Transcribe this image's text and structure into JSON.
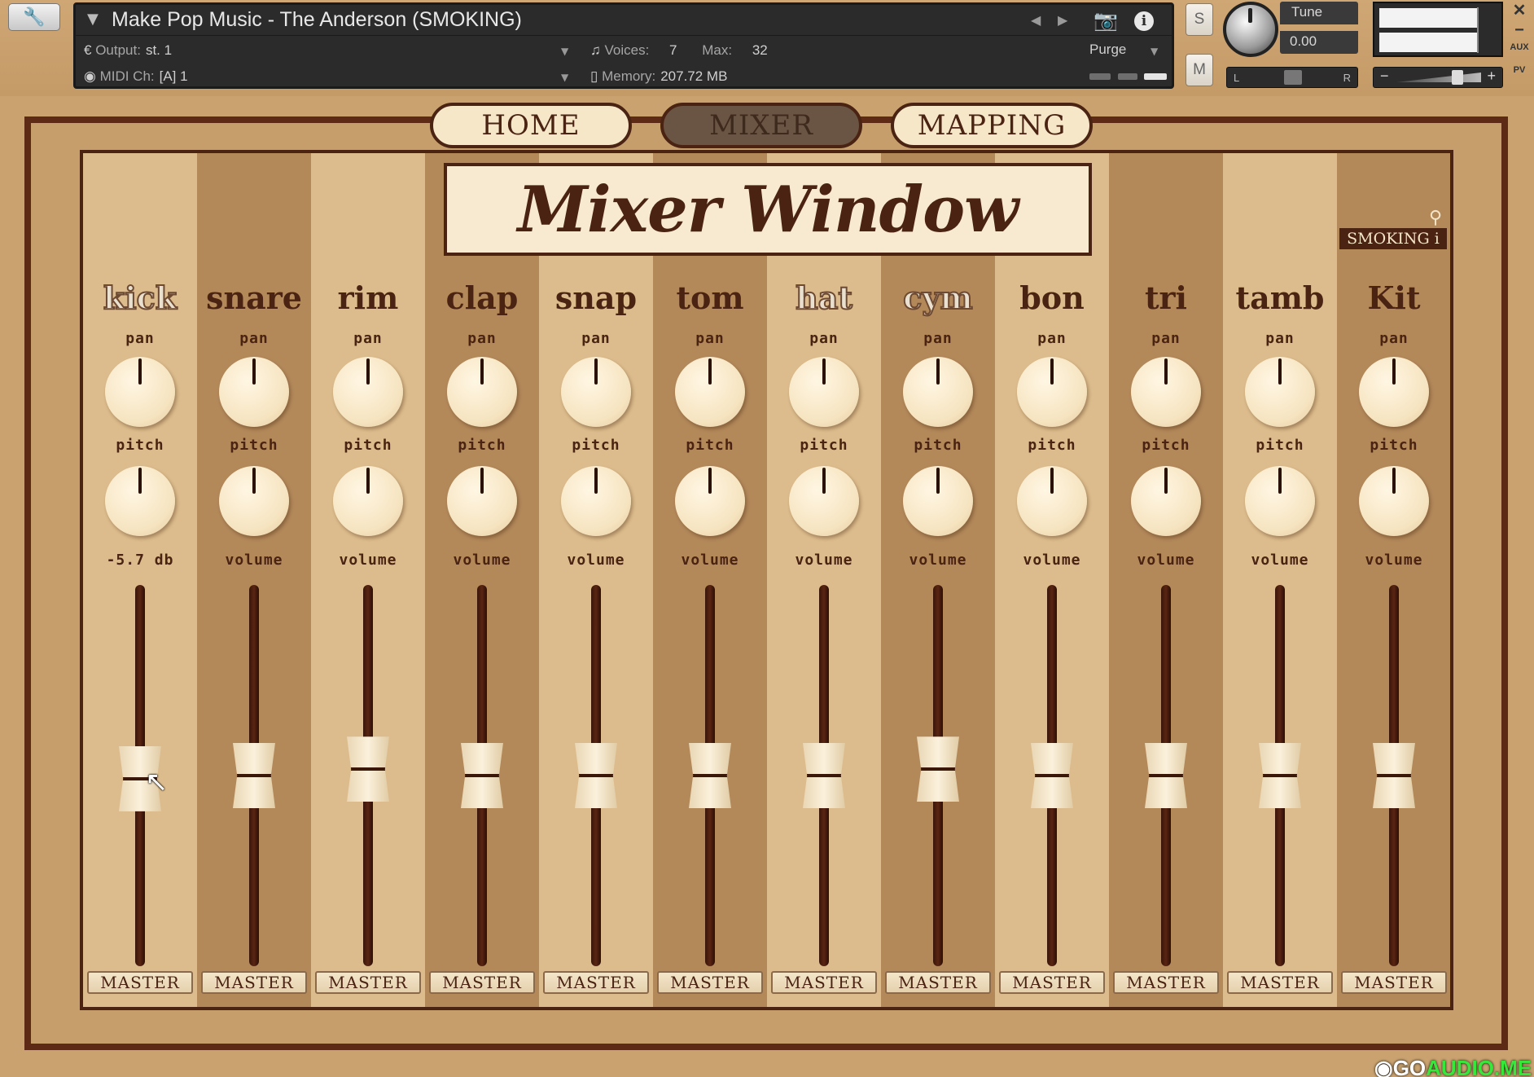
{
  "header": {
    "title": "Make Pop Music - The Anderson (SMOKING)",
    "output_label": "Output:",
    "output_value": "st. 1",
    "midi_label": "MIDI Ch:",
    "midi_value": "[A]  1",
    "voices_label": "Voices:",
    "voices_value": "7",
    "max_label": "Max:",
    "max_value": "32",
    "memory_label": "Memory:",
    "memory_value": "207.72 MB",
    "purge_label": "Purge",
    "solo_label": "S",
    "mute_label": "M",
    "tune_label": "Tune",
    "tune_value": "0.00",
    "pan_left": "L",
    "pan_right": "R",
    "vol_minus": "−",
    "vol_plus": "+",
    "side_aux": "AUX",
    "side_pv": "PV"
  },
  "tabs": [
    {
      "label": "HOME",
      "active": false
    },
    {
      "label": "MIXER",
      "active": true
    },
    {
      "label": "MAPPING",
      "active": false
    }
  ],
  "mixer": {
    "title": "Mixer Window",
    "kit_badge": "SMOKING",
    "pan_label": "pan",
    "pitch_label": "pitch",
    "master_label": "MASTER",
    "channels": [
      {
        "name": "kick",
        "volume_label": "-5.7 db",
        "muted": true,
        "fader_level": 0.49
      },
      {
        "name": "snare",
        "volume_label": "volume",
        "muted": false,
        "fader_level": 0.5
      },
      {
        "name": "rim",
        "volume_label": "volume",
        "muted": false,
        "fader_level": 0.52
      },
      {
        "name": "clap",
        "volume_label": "volume",
        "muted": false,
        "fader_level": 0.5
      },
      {
        "name": "snap",
        "volume_label": "volume",
        "muted": false,
        "fader_level": 0.5
      },
      {
        "name": "tom",
        "volume_label": "volume",
        "muted": false,
        "fader_level": 0.5
      },
      {
        "name": "hat",
        "volume_label": "volume",
        "muted": true,
        "fader_level": 0.5
      },
      {
        "name": "cym",
        "volume_label": "volume",
        "muted": true,
        "fader_level": 0.52
      },
      {
        "name": "bon",
        "volume_label": "volume",
        "muted": false,
        "fader_level": 0.5
      },
      {
        "name": "tri",
        "volume_label": "volume",
        "muted": false,
        "fader_level": 0.5
      },
      {
        "name": "tamb",
        "volume_label": "volume",
        "muted": false,
        "fader_level": 0.5
      },
      {
        "name": "Kit",
        "volume_label": "volume",
        "muted": false,
        "fader_level": 0.5
      }
    ]
  },
  "colors": {
    "strip_light": "#dcbc8c",
    "strip_dark": "#b3895a",
    "frame": "#5c2a15",
    "ink": "#4a2313"
  },
  "watermark": {
    "prefix": "GO",
    "suffix": "AUDIO.ME"
  }
}
